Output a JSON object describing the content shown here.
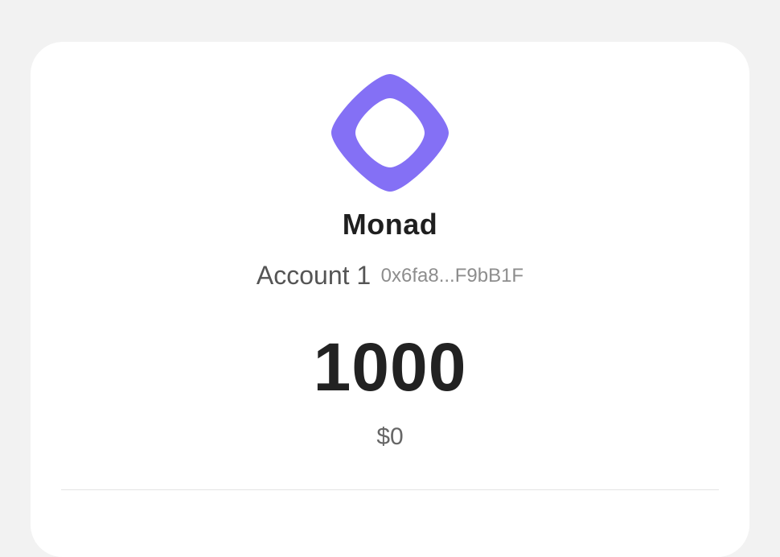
{
  "token": {
    "name": "Monad",
    "logo_icon": "monad-logo-icon",
    "logo_color": "#8470f5"
  },
  "account": {
    "name": "Account 1",
    "address": "0x6fa8...F9bB1F"
  },
  "balance": {
    "amount": "1000",
    "fiat": "$0"
  }
}
